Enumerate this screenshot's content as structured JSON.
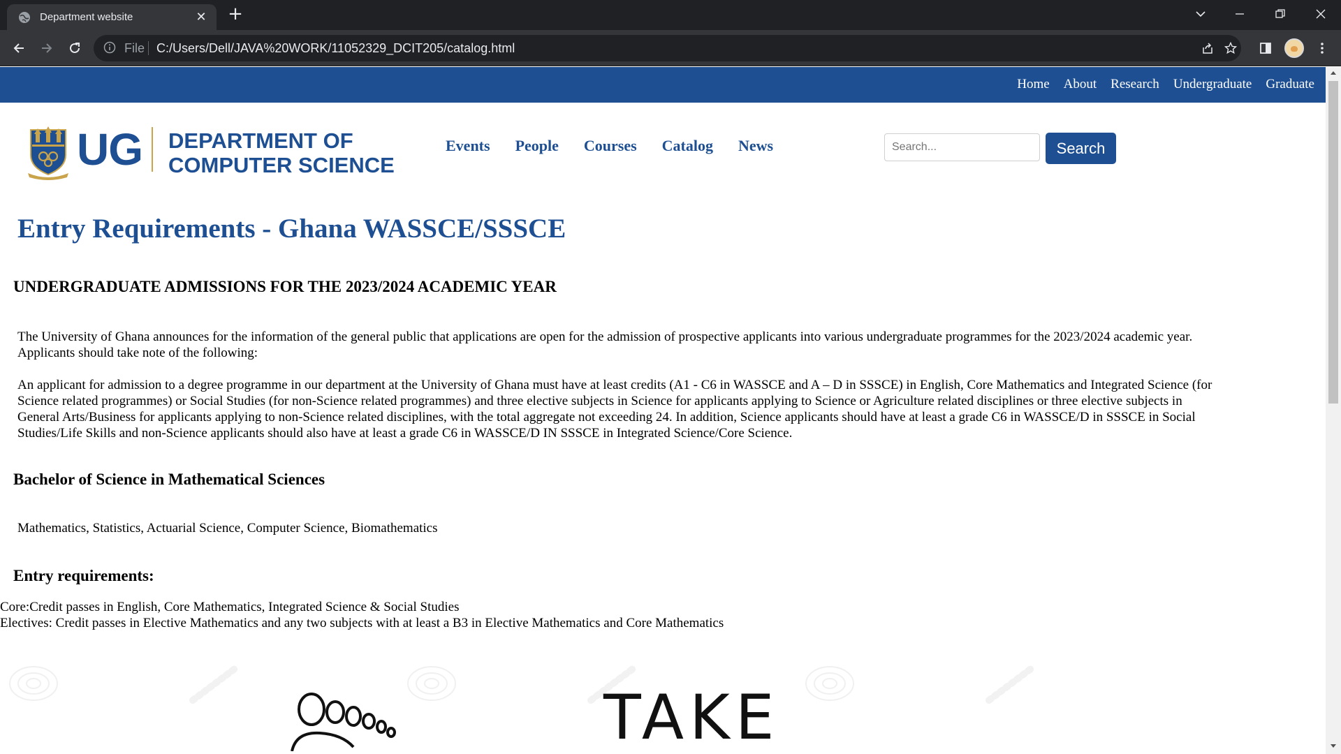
{
  "browser": {
    "tab_title": "Department website",
    "address_scheme": "File",
    "url": "C:/Users/Dell/JAVA%20WORK/11052329_DCIT205/catalog.html"
  },
  "icons": {
    "tab_favicon": "globe-icon",
    "tab_close": "close-icon",
    "new_tab": "plus-icon",
    "back": "arrow-left-icon",
    "forward": "arrow-right-icon",
    "reload": "reload-icon",
    "site_info": "info-icon",
    "share": "share-icon",
    "bookmark": "star-icon",
    "side_panel": "side-panel-icon",
    "profile": "avatar",
    "menu": "kebab-menu-icon",
    "minimize": "minimize-icon",
    "restore": "restore-icon",
    "close_window": "close-icon",
    "tab_search": "chevron-down-icon"
  },
  "colors": {
    "brand_blue": "#1d4f92",
    "gold_accent": "#c9a44b",
    "chrome_dark": "#202124",
    "chrome_toolbar": "#35363a"
  },
  "top_nav": [
    "Home",
    "About",
    "Research",
    "Undergraduate",
    "Graduate"
  ],
  "logo": {
    "short": "UG",
    "line1": "DEPARTMENT OF",
    "line2": "COMPUTER SCIENCE"
  },
  "main_nav": [
    "Events",
    "People",
    "Courses",
    "Catalog",
    "News"
  ],
  "search": {
    "placeholder": "Search...",
    "button_label": "Search"
  },
  "content": {
    "page_title": "Entry Requirements - Ghana WASSCE/SSSCE",
    "admissions_heading": "UNDERGRADUATE ADMISSIONS FOR THE 2023/2024 ACADEMIC YEAR",
    "paragraph1": "The University of Ghana announces for the information of the general public that applications are open for the admission of prospective applicants into various undergraduate programmes for the 2023/2024 academic year. Applicants should take note of the following:",
    "paragraph2": "An applicant for admission to a degree programme in our department at the University of Ghana must have at least credits (A1 - C6 in WASSCE and A – D in SSSCE) in English, Core Mathematics and Integrated Science (for Science related programmes) or Social Studies (for non-Science related programmes) and three elective subjects in Science for applicants applying to Science or Agriculture related disciplines or three elective subjects in General Arts/Business for applicants applying to non-Science related disciplines, with the total aggregate not exceeding 24. In addition, Science applicants should have at least a grade C6 in WASSCE/D in SSSCE in Social Studies/Life Skills and non-Science applicants should also have at least a grade C6 in WASSCE/D IN SSSCE in Integrated Science/Core Science.",
    "bsc_heading": "Bachelor of Science in Mathematical Sciences",
    "programmes": "Mathematics, Statistics, Actuarial Science, Computer Science, Biomathematics",
    "entry_heading": "Entry requirements:",
    "core_requirement": "Core:Credit passes in English, Core Mathematics, Integrated Science & Social Studies",
    "elective_requirement": "Electives: Credit passes in Elective Mathematics and any two subjects with at least a B3 in Elective Mathematics and Core Mathematics"
  },
  "banner": {
    "headline": "TAKE",
    "doodle_text": "Oooooo"
  }
}
